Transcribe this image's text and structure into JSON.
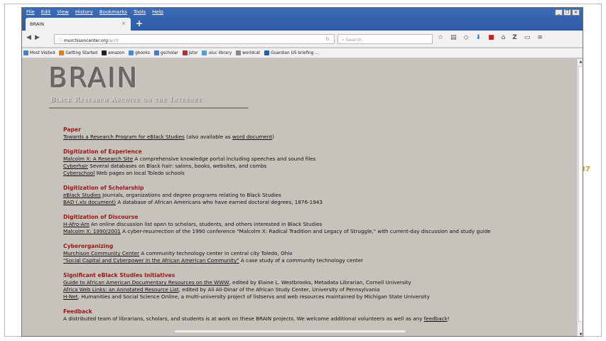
{
  "slide": {
    "page_number": "37"
  },
  "browser": {
    "menu": [
      "File",
      "Edit",
      "View",
      "History",
      "Bookmarks",
      "Tools",
      "Help"
    ],
    "tab_title": "BRAIN",
    "url_host": "murchisoncenter.org",
    "url_path": "/acrl/",
    "search_placeholder": "Search",
    "bookmarks": [
      {
        "label": "Most Visited",
        "color": "#4a7fd0"
      },
      {
        "label": "Getting Started",
        "color": "#e07a1f"
      },
      {
        "label": "amazon",
        "color": "#222222"
      },
      {
        "label": "gbooks",
        "color": "#3a8ee6"
      },
      {
        "label": "gscholar",
        "color": "#4a78d0"
      },
      {
        "label": "jstor",
        "color": "#b03030"
      },
      {
        "label": "uiuc library",
        "color": "#5b9bd5"
      },
      {
        "label": "worldcat",
        "color": "#888888"
      },
      {
        "label": "Guardian US briefing ...",
        "color": "#2a5fa8"
      }
    ]
  },
  "page": {
    "logo": "BRAIN",
    "logo_sub": "Black Research Archive on the Internet",
    "sections": [
      {
        "title": "Paper",
        "items": [
          {
            "link": "Towards a Research Program for eBlack Studies",
            "text": " (also available as ",
            "link2": "word document",
            "text2": ")"
          }
        ]
      },
      {
        "title": "Digitization of Experience",
        "items": [
          {
            "link": "Malcolm X: A Research Site",
            "text": " A comprehensive knowledge portal including speeches and sound files"
          },
          {
            "link": "Cyberhair",
            "text": " Several databases on Black hair: salons, books, websites, and combs"
          },
          {
            "link": "Cyberschool",
            "text": " Web pages on local Toledo schools"
          }
        ]
      },
      {
        "title": "Digitization of Scholarship",
        "items": [
          {
            "link": "eBlack Studies",
            "text": " Journals, organizations and degree programs relating to Black Studies"
          },
          {
            "link": "BAD (.xls document)",
            "text": " A database of African Americans who have earned doctoral degrees, 1876-1943"
          }
        ]
      },
      {
        "title": "Digitization of Discourse",
        "items": [
          {
            "link": "H-Afro-Am",
            "text": " An online discussion list open to scholars, students, and others interested in Black Studies"
          },
          {
            "link": "Malcolm X: 1990/2001",
            "text": " A cyber-resurrection of the 1990 conference \"Malcolm X: Radical Tradition and Legacy of Struggle,\" with current-day discussion and study guide"
          }
        ]
      },
      {
        "title": "Cyberorganizing",
        "items": [
          {
            "link": "Murchison Community Center",
            "text": " A community technology center in central city Toledo, Ohio"
          },
          {
            "link": "\"Social Capital and Cyberpower in the African American Community\"",
            "text": " A case study of a community technology center"
          }
        ]
      },
      {
        "title": "Significant eBlack Studies Initiatives",
        "items": [
          {
            "link": "Guide to African American Documentary Resources on the WWW",
            "text": ", edited by Elaine L. Westbrooks, Metadata Librarian, Cornell University"
          },
          {
            "link": "Africa Web Links: an Annotated Resource List",
            "text": ", edited by Ali Ali-Dinar of the African Study Center, University of Pennsylvania"
          },
          {
            "link": "H-Net",
            "text": ", Humanities and Social Science Online, a multi-university project of listservs and web resources maintained by Michigan State University"
          }
        ]
      },
      {
        "title": "Feedback",
        "items": [
          {
            "link": "",
            "text": "A distributed team of librarians, scholars, and students is at work on these BRAIN projects. We welcome additional volunteers as well as any ",
            "link2": "feedback",
            "text2": "!"
          }
        ]
      }
    ]
  }
}
